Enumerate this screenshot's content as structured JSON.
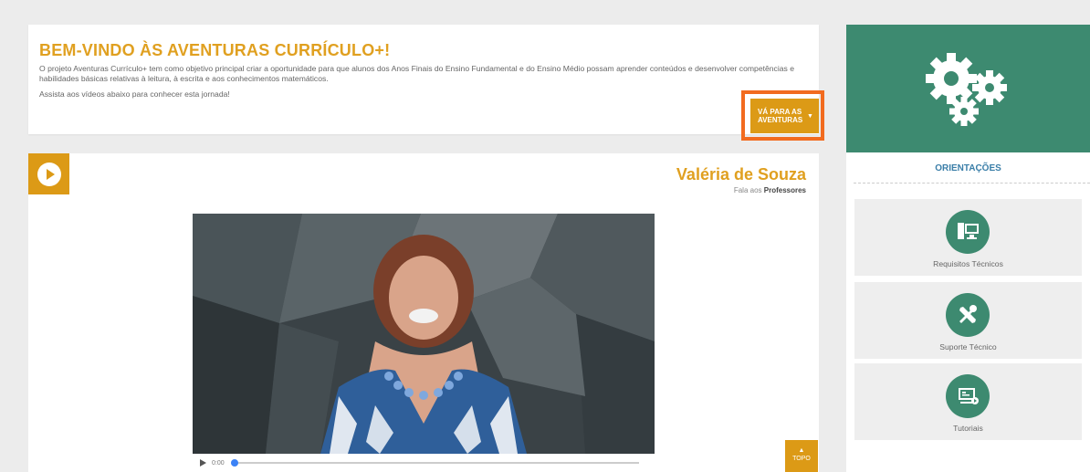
{
  "welcome": {
    "title": "BEM-VINDO ÀS AVENTURAS CURRÍCULO+!",
    "description": "O projeto Aventuras Currículo+ tem como objetivo principal criar a oportunidade para que alunos dos Anos Finais do Ensino Fundamental e do Ensino Médio possam aprender conteúdos e desenvolver competências e habilidades básicas relativas à leitura, à escrita e aos conhecimentos matemáticos.",
    "hint": "Assista aos vídeos abaixo para conhecer esta jornada!",
    "adventure_button": "VÁ PARA AS AVENTURAS"
  },
  "video": {
    "speaker_name": "Valéria de Souza",
    "subtitle_prefix": "Fala aos",
    "subtitle_audience": "Professores",
    "time": "0:00",
    "progress": 0,
    "top_button": "TOPO"
  },
  "sidebar": {
    "heading": "ORIENTAÇÕES",
    "items": [
      {
        "label": "Requisitos Técnicos",
        "icon": "computer-icon"
      },
      {
        "label": "Suporte Técnico",
        "icon": "tools-icon"
      },
      {
        "label": "Tutoriais",
        "icon": "tutorial-icon"
      }
    ]
  },
  "colors": {
    "accent": "#dc9a16",
    "title": "#e0a020",
    "highlight": "#f26b1f",
    "green": "#3d8a70",
    "link_blue": "#3a7ea8"
  }
}
